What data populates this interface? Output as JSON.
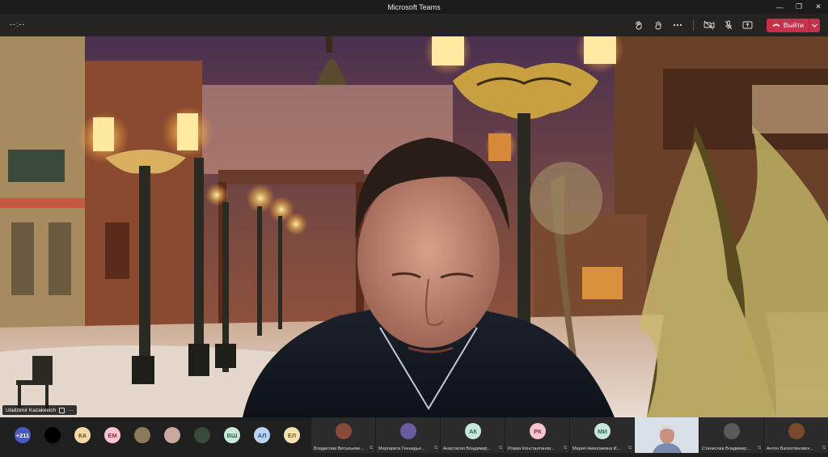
{
  "window": {
    "title": "Microsoft Teams",
    "controls": [
      "—",
      "❐",
      "✕"
    ]
  },
  "toolbar": {
    "timer": "--:--",
    "icons": [
      "reactions-icon",
      "raise-hand-icon",
      "more-icon",
      "camera-off-icon",
      "mic-icon",
      "share-icon"
    ],
    "leave_label": "Выйти"
  },
  "main_video": {
    "participant_name": "Uladzimir Kazakevich"
  },
  "participants_strip": {
    "overflow_count": "+211",
    "avatars": [
      {
        "initials": "",
        "bg": "#000000",
        "fg": "#ffffff"
      },
      {
        "initials": "КА",
        "bg": "#f3d9a8",
        "fg": "#6b4b12"
      },
      {
        "initials": "ЕМ",
        "bg": "#f6c5cf",
        "fg": "#8a2f44"
      },
      {
        "initials": "",
        "bg": "#8a7a5a",
        "fg": "#ffffff"
      },
      {
        "initials": "",
        "bg": "#c9a9a0",
        "fg": "#ffffff"
      },
      {
        "initials": "",
        "bg": "#3a4a3a",
        "fg": "#ffffff"
      },
      {
        "initials": "ВШ",
        "bg": "#c7e8d8",
        "fg": "#2f6b4e"
      },
      {
        "initials": "АЛ",
        "bg": "#bcd3f0",
        "fg": "#29508a"
      },
      {
        "initials": "ЕЛ",
        "bg": "#f4e2b4",
        "fg": "#7a5c12"
      }
    ],
    "tiles": [
      {
        "name": "Владислав Витальеви...",
        "initials": "",
        "bg": "#8a4a3a",
        "cam": false
      },
      {
        "name": "Маргарита Геннадье...",
        "initials": "",
        "bg": "#6a5aa0",
        "cam": false
      },
      {
        "name": "Анастасия Владимир...",
        "initials": "АК",
        "bg": "#c7e8d8",
        "fg": "#2f6b4e",
        "cam": false
      },
      {
        "name": "Роман Константинов...",
        "initials": "РК",
        "bg": "#f6c5cf",
        "fg": "#8a2f44",
        "cam": false
      },
      {
        "name": "Мария Николаевна И...",
        "initials": "МИ",
        "bg": "#c7e8d8",
        "fg": "#2f6b4e",
        "cam": false
      },
      {
        "name": "",
        "initials": "",
        "bg": "#cfd6dd",
        "cam": true
      },
      {
        "name": "Станислав Владимир...",
        "initials": "",
        "bg": "#5a5a5a",
        "cam": false
      },
      {
        "name": "Антон Валентинович...",
        "initials": "",
        "bg": "#7a4a30",
        "cam": false
      }
    ]
  }
}
